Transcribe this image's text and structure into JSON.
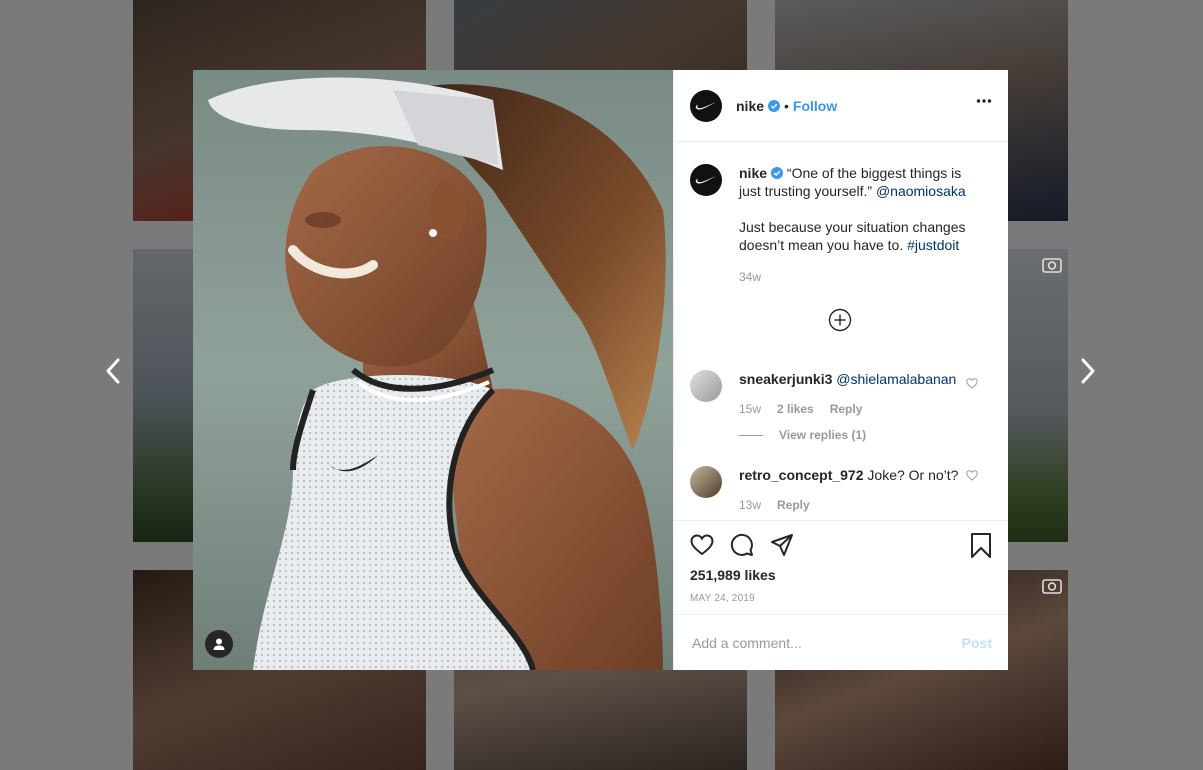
{
  "post": {
    "username": "nike",
    "follow_label": "Follow",
    "dot": "•",
    "caption": {
      "username": "nike",
      "line1": "“One of the biggest things is just trusting yourself.”",
      "mention": "@naomiosaka",
      "line2": "Just because your situation changes doesn’t mean you have to.",
      "hashtag": "#justdoit",
      "age": "34w"
    },
    "comments": [
      {
        "username": "sneakerjunki3",
        "mention": "@shielamalabanan",
        "age": "15w",
        "likes": "2 likes",
        "reply_label": "Reply",
        "view_replies": "View replies (1)"
      },
      {
        "username": "retro_concept_972",
        "text": "Joke? Or no’t?",
        "age": "13w",
        "reply_label": "Reply"
      }
    ],
    "likes_count": "251,989 likes",
    "date": "MAY 24, 2019",
    "comment_placeholder": "Add a comment...",
    "post_label": "Post"
  },
  "icons": {
    "verified": "verified-badge-icon",
    "more": "more-options-icon",
    "like": "heart-icon",
    "comment": "comment-icon",
    "share": "share-icon",
    "save": "bookmark-icon",
    "load_more": "plus-circle-icon",
    "user_tag": "user-tag-icon",
    "prev": "chevron-left-icon",
    "next": "chevron-right-icon",
    "video": "video-camera-icon"
  },
  "colors": {
    "accent": "#3897f0",
    "link": "#003569",
    "text": "#262626",
    "muted": "#999999",
    "divider": "#efefef",
    "backdrop": "rgba(0,0,0,0.5)"
  }
}
